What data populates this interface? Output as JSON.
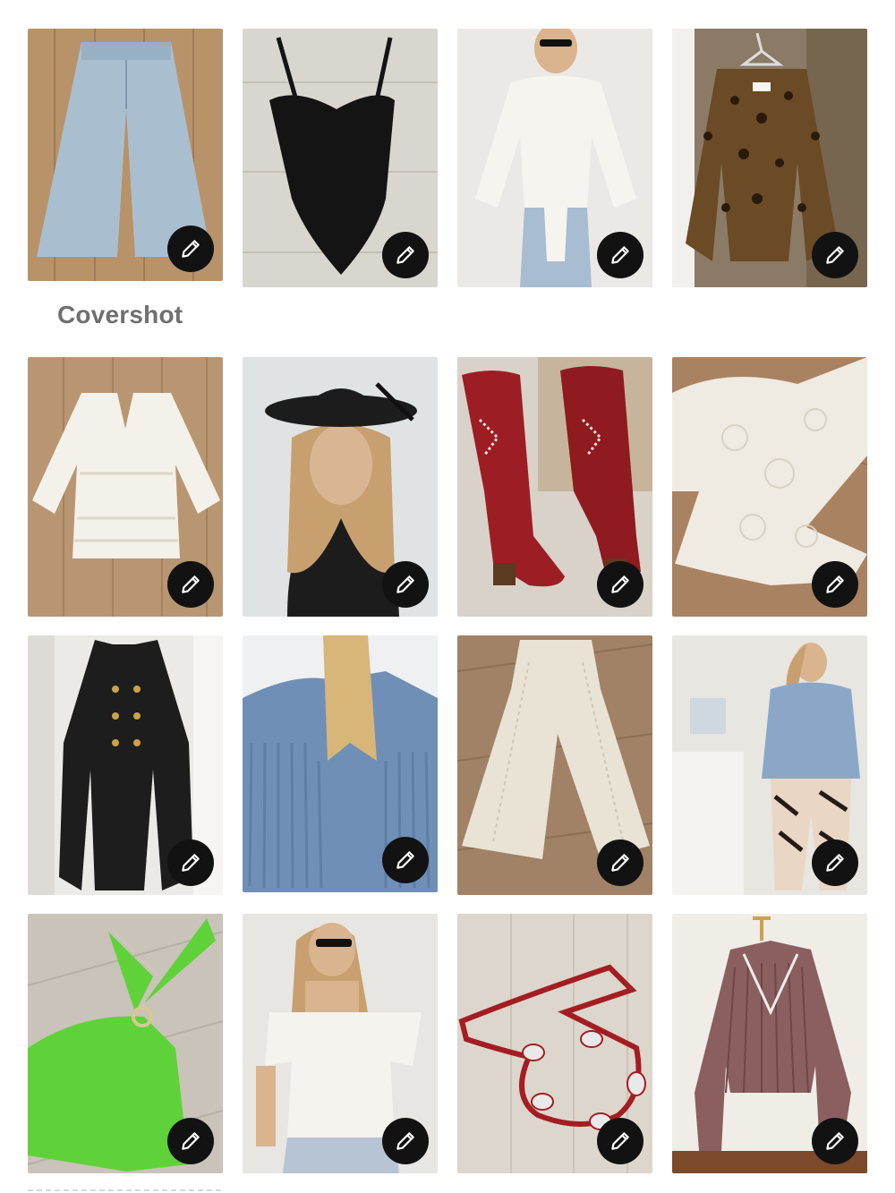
{
  "section": {
    "label": "Covershot"
  },
  "rows": [
    {
      "items": [
        {
          "name": "light-wash-wide-leg-jeans",
          "bg": "#b8936a",
          "accent": "#a9bfd0",
          "shape": "pants"
        },
        {
          "name": "black-bodysuit",
          "bg": "#d9d6cf",
          "accent": "#141414",
          "shape": "bodysuit"
        },
        {
          "name": "white-eyelet-tie-top",
          "bg": "#ebe9e6",
          "accent": "#f6f4ef",
          "shape": "person"
        },
        {
          "name": "leopard-print-blazer",
          "bg": "#8a7a66",
          "accent": "#6b4a26",
          "shape": "jacket"
        }
      ]
    },
    {
      "items": [
        {
          "name": "white-lace-tunic",
          "bg": "#b99672",
          "accent": "#f4f1ea",
          "shape": "tunic"
        },
        {
          "name": "black-veiled-hat-selfie",
          "bg": "#dfe3e4",
          "accent": "#1c1c1c",
          "shape": "portrait"
        },
        {
          "name": "red-cowboy-boots",
          "bg": "#d8d2c9",
          "accent": "#9c1e24",
          "shape": "boots"
        },
        {
          "name": "white-lace-bell-sleeve-top",
          "bg": "#a98262",
          "accent": "#efeae2",
          "shape": "lace"
        }
      ]
    },
    {
      "items": [
        {
          "name": "black-sheer-long-coat",
          "bg": "#eceae7",
          "accent": "#1d1d1d",
          "shape": "coat"
        },
        {
          "name": "blue-fringe-denim-jacket",
          "bg": "#eef0f1",
          "accent": "#6f8fb6",
          "shape": "fringe"
        },
        {
          "name": "cream-crochet-flare-pants",
          "bg": "#a18266",
          "accent": "#e9e3d6",
          "shape": "pants"
        },
        {
          "name": "denim-jacket-zebra-pants",
          "bg": "#e8e6e1",
          "accent": "#8aa7c8",
          "shape": "person"
        }
      ]
    },
    {
      "items": [
        {
          "name": "green-crochet-halter-dress",
          "bg": "#c9c3b9",
          "accent": "#5fd23a",
          "shape": "dress"
        },
        {
          "name": "white-lace-off-shoulder-top",
          "bg": "#e7e6e3",
          "accent": "#f5f3ee",
          "shape": "person"
        },
        {
          "name": "red-concho-belt",
          "bg": "#dcd6cc",
          "accent": "#a31d22",
          "shape": "belt"
        },
        {
          "name": "mauve-striped-wrap-top",
          "bg": "#f0ede7",
          "accent": "#8b5f5f",
          "shape": "blouse"
        }
      ]
    }
  ]
}
